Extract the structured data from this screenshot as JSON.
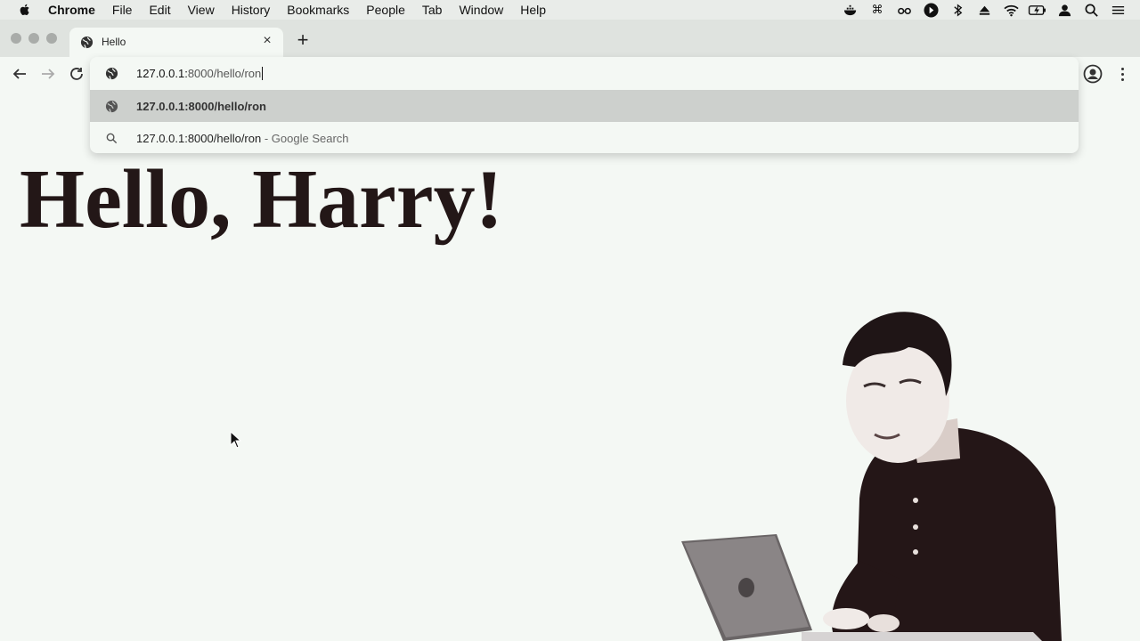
{
  "menubar": {
    "app_name": "Chrome",
    "items": [
      "File",
      "Edit",
      "View",
      "History",
      "Bookmarks",
      "People",
      "Tab",
      "Window",
      "Help"
    ],
    "status_icons": [
      "docker-icon",
      "command-icon",
      "glasses-icon",
      "play-icon",
      "bluetooth-icon",
      "eject-icon",
      "wifi-icon",
      "battery-icon",
      "user-icon",
      "search-icon",
      "control-center-icon"
    ]
  },
  "tab": {
    "title": "Hello",
    "favicon": "globe-icon",
    "close_label": "×",
    "new_tab_label": "+"
  },
  "omnibox": {
    "input_host": "127.0.0.1:",
    "input_path": "8000/hello/ron",
    "suggestions": [
      {
        "icon": "globe-icon",
        "text": "127.0.0.1:8000/hello/ron",
        "suffix": ""
      },
      {
        "icon": "search-icon",
        "text": "127.0.0.1:8000/hello/ron",
        "suffix": " - Google Search"
      }
    ]
  },
  "page": {
    "heading": "Hello, Harry!"
  },
  "colors": {
    "page_background": "#f4f8f4",
    "heading_color": "#231717",
    "selected_suggestion": "#cdd0cd"
  }
}
